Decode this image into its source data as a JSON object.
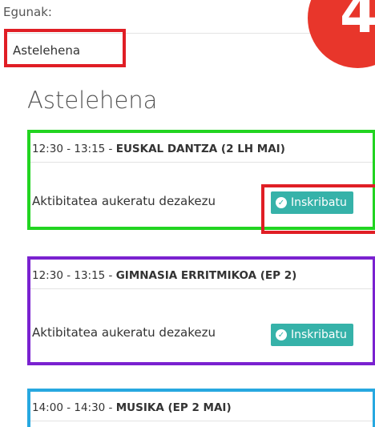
{
  "form": {
    "day_label": "Egunak:",
    "day_select_value": "Astelehena"
  },
  "day_heading": "Astelehena",
  "activities": [
    {
      "time": "12:30 - 13:15 - ",
      "title": "EUSKAL DANTZA (2 LH MAI)",
      "message": "Aktibitatea aukeratu dezakezu",
      "button_label": "Inskribatu"
    },
    {
      "time": "12:30 - 13:15 - ",
      "title": "GIMNASIA ERRITMIKOA (EP 2)",
      "message": "Aktibitatea aukeratu dezakezu",
      "button_label": "Inskribatu"
    },
    {
      "time": "14:00 - 14:30 - ",
      "title": "MUSIKA (EP 2 MAI)"
    }
  ],
  "step_badge": "4",
  "colors": {
    "highlight_red": "#e01e25",
    "card1_border": "#22d421",
    "card2_border": "#7a22d0",
    "card3_border": "#27a8e0",
    "button_teal": "#36b2a9",
    "badge_red": "#e8362b"
  },
  "icons": {
    "button_icon": "check-circle-icon"
  }
}
